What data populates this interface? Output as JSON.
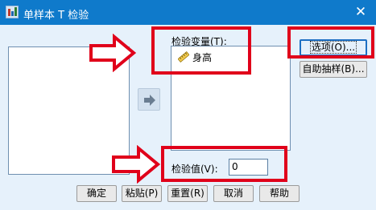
{
  "window": {
    "title": "单样本 T 检验",
    "close_glyph": "✕"
  },
  "test_variables": {
    "label": "检验变量(T):",
    "items": [
      {
        "name": "身高",
        "icon": "scale-variable-icon"
      }
    ]
  },
  "test_value": {
    "label": "检验值(V):",
    "value": "0"
  },
  "side_buttons": {
    "options": "选项(O)...",
    "bootstrap": "自助抽样(B)..."
  },
  "bottom_buttons": {
    "ok": "确定",
    "paste": "粘贴(P)",
    "reset": "重置(R)",
    "cancel": "取消",
    "help": "帮助"
  },
  "colors": {
    "titlebar": "#0f7acb",
    "dialog_bg": "#e6f1fb",
    "annotation_red": "#e0001a"
  }
}
